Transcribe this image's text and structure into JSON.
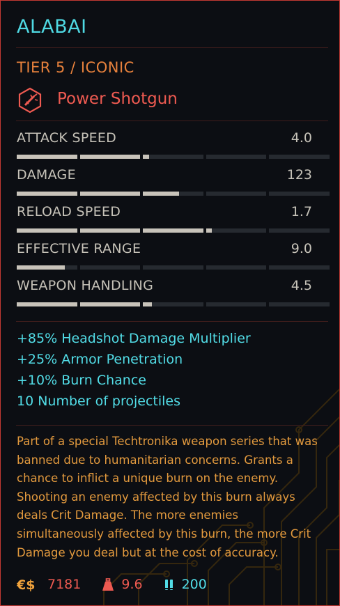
{
  "item": {
    "name": "ALABAI",
    "tier": "TIER 5 / ICONIC",
    "weapon_type": "Power Shotgun",
    "weapon_type_icon": "power-shotgun-icon"
  },
  "stats": [
    {
      "label": "ATTACK SPEED",
      "value": "4.0",
      "bar_fill_fraction": 0.42
    },
    {
      "label": "DAMAGE",
      "value": "123",
      "bar_fill_fraction": 0.52
    },
    {
      "label": "RELOAD SPEED",
      "value": "1.7",
      "bar_fill_fraction": 0.62
    },
    {
      "label": "EFFECTIVE RANGE",
      "value": "9.0",
      "bar_fill_fraction": 0.16
    },
    {
      "label": "WEAPON HANDLING",
      "value": "4.5",
      "bar_fill_fraction": 0.43
    }
  ],
  "modifiers": [
    "+85% Headshot Damage Multiplier",
    "+25% Armor Penetration",
    "+10% Burn Chance",
    "10 Number of projectiles"
  ],
  "description": "Part of a special Techtronika weapon series that was banned due to humanitarian concerns. Grants a chance to inflict a unique burn on the enemy. Shooting an enemy affected by this burn always deals Crit Damage. The more enemies simultaneously affected by this burn, the more Crit Damage you deal but at the cost of accuracy.",
  "footer": {
    "price": "7181",
    "price_icon": "eurodollar-icon",
    "weight": "9.6",
    "weight_icon": "weight-icon",
    "ammo": "200",
    "ammo_icon": "ammo-icon"
  },
  "colors": {
    "title": "#4fd9e3",
    "tier": "#e7813c",
    "weapon_type": "#ee5a51",
    "stat_text": "#c6c2b8",
    "bar_fill": "#c8c3ba",
    "bar_empty": "#262a30",
    "modifier": "#52dde7",
    "description": "#e39a3e",
    "price": "#ee5a51",
    "ammo": "#52dde7",
    "border": "#c43a33"
  }
}
